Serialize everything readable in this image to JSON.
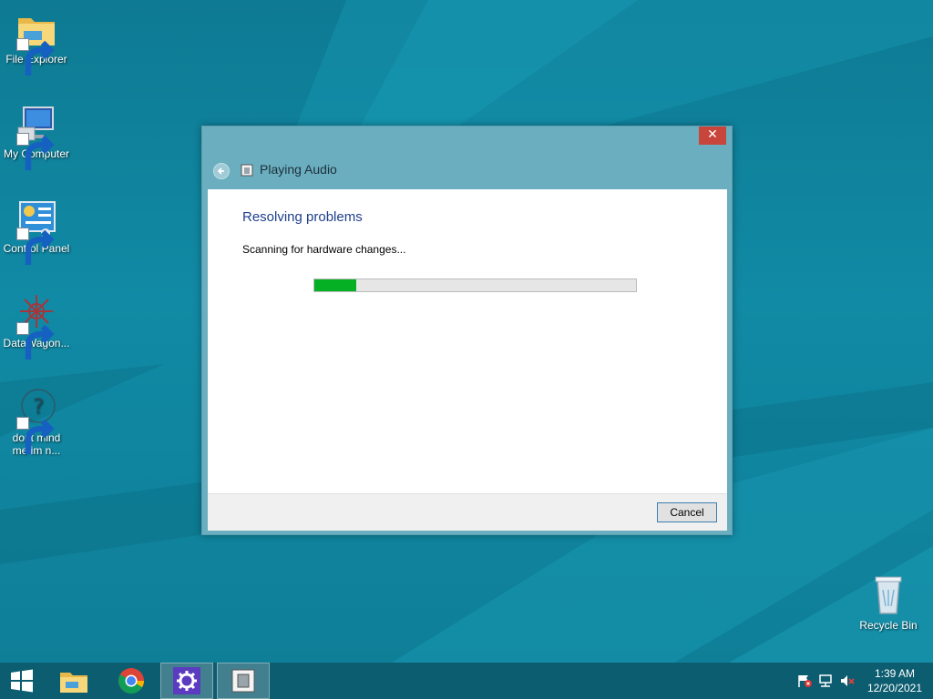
{
  "desktop": {
    "icons": [
      {
        "label": "File Explorer",
        "icon": "folder-icon"
      },
      {
        "label": "My Computer",
        "icon": "computer-icon"
      },
      {
        "label": "Control Panel",
        "icon": "control-panel-icon"
      },
      {
        "label": "DataWagon...",
        "icon": "datawagon-icon"
      },
      {
        "label": "dont mind me im n...",
        "icon": "question-icon"
      },
      {
        "label": "Recycle Bin",
        "icon": "recycle-bin-icon"
      }
    ]
  },
  "dialog": {
    "title": "Playing Audio",
    "close_glyph": "✕",
    "heading": "Resolving problems",
    "status": "Scanning for hardware changes...",
    "progress_fraction": 0.13,
    "cancel_label": "Cancel"
  },
  "taskbar": {
    "items": [
      "start-icon",
      "file-explorer-icon",
      "chrome-icon",
      "settings-icon",
      "troubleshooter-icon"
    ],
    "active": [
      "settings-icon",
      "troubleshooter-icon"
    ],
    "tray": [
      "action-center-flag-icon",
      "network-icon",
      "volume-muted-icon"
    ],
    "time": "1:39 AM",
    "date": "12/20/2021"
  },
  "colors": {
    "desktop_bg": "#0f7d96",
    "dialog_frame": "#6aaec0",
    "heading": "#1e3f8c",
    "progress_fill": "#06b025",
    "close_button": "#c7453a",
    "taskbar": "#0d5d70"
  }
}
